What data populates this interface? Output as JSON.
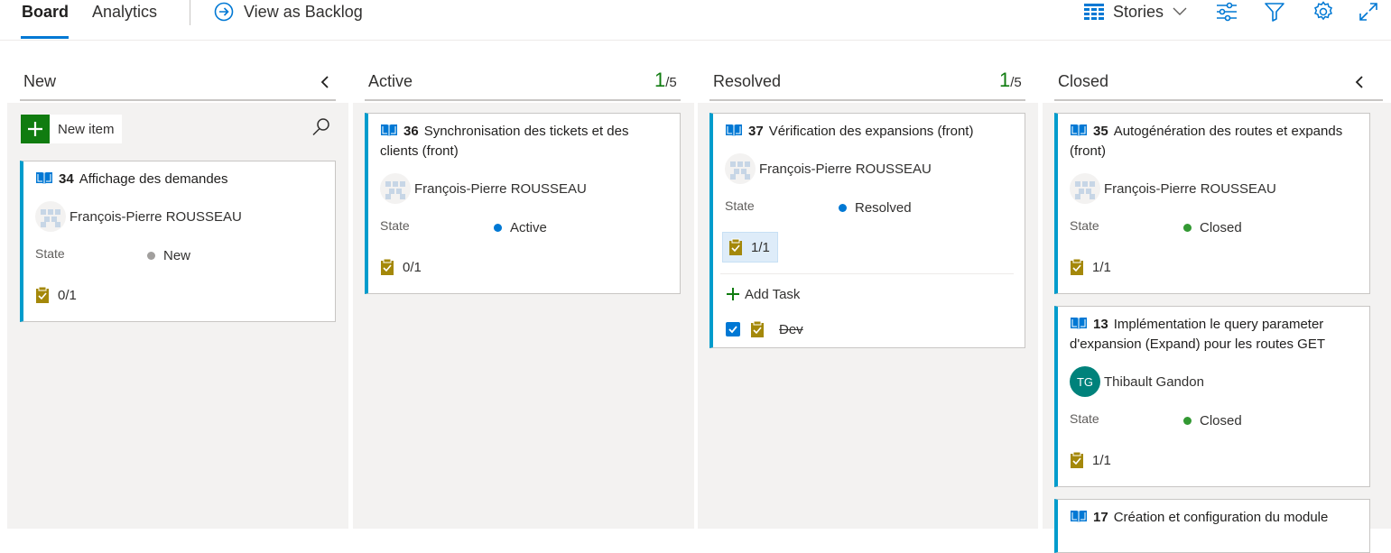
{
  "tabs": {
    "board": "Board",
    "analytics": "Analytics"
  },
  "backlog_link": "View as Backlog",
  "toolbar": {
    "level": "Stories",
    "icons": [
      "settings-sliders-icon",
      "filter-icon",
      "gear-icon",
      "expand-icon"
    ]
  },
  "columns": [
    {
      "title": "New",
      "collapsible": true
    },
    {
      "title": "Active",
      "count": "1",
      "limit": "/5"
    },
    {
      "title": "Resolved",
      "count": "1",
      "limit": "/5"
    },
    {
      "title": "Closed",
      "collapsible": true
    }
  ],
  "new_item": "New item",
  "state_label": "State",
  "add_task": "Add Task",
  "cards": [
    {
      "id": "34",
      "title": "Affichage des demandes",
      "assignee": "François-Pierre ROUSSEAU",
      "state": "New",
      "state_color": "#a19f9d",
      "tasks": "0/1"
    },
    {
      "id": "36",
      "title": "Synchronisation des tickets et des clients (front)",
      "assignee": "François-Pierre ROUSSEAU",
      "state": "Active",
      "state_color": "#0078d4",
      "tasks": "0/1"
    },
    {
      "id": "37",
      "title": "Vérification des expansions (front)",
      "assignee": "François-Pierre ROUSSEAU",
      "state": "Resolved",
      "state_color": "#0078d4",
      "tasks": "1/1",
      "child_tasks": [
        {
          "title": "Dev",
          "done": true
        }
      ]
    },
    {
      "id": "35",
      "title": "Autogénération des routes et expands (front)",
      "assignee": "François-Pierre ROUSSEAU",
      "state": "Closed",
      "state_color": "#339933",
      "tasks": "1/1"
    },
    {
      "id": "13",
      "title": "Implémentation le query parameter d'expansion (Expand)  pour les routes GET",
      "assignee": "Thibault Gandon",
      "assignee_initials": "TG",
      "state": "Closed",
      "state_color": "#339933",
      "tasks": "1/1"
    },
    {
      "id": "17",
      "title": "Création et configuration du module"
    }
  ]
}
